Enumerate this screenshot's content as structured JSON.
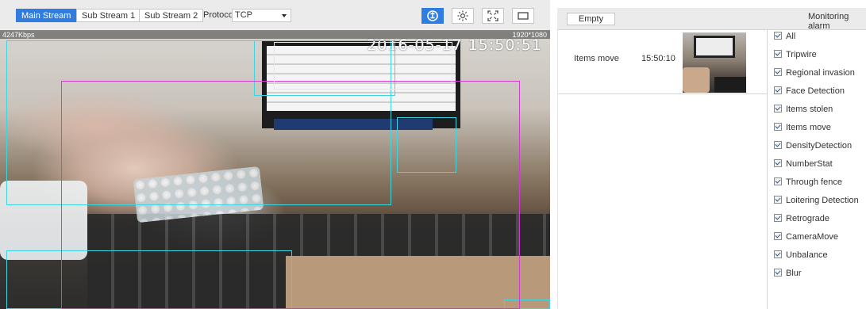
{
  "toolbar": {
    "streams": [
      {
        "label": "Main Stream",
        "active": true
      },
      {
        "label": "Sub Stream 1",
        "active": false
      },
      {
        "label": "Sub Stream 2",
        "active": false
      }
    ],
    "protocol_label": "Protocol",
    "protocol_value": "TCP",
    "icons": [
      {
        "name": "rule-overlay-icon",
        "active": true
      },
      {
        "name": "brightness-icon",
        "active": false
      },
      {
        "name": "fullscreen-icon",
        "active": false
      },
      {
        "name": "aspect-ratio-icon",
        "active": false
      }
    ]
  },
  "video": {
    "bitrate": "4247Kbps",
    "resolution": "1920*1080",
    "timestamp": "2016-05-17 15:50:51"
  },
  "alarm_panel": {
    "empty_label": "Empty",
    "title": "Monitoring alarm",
    "events": [
      {
        "type": "Items move",
        "time": "15:50:10"
      }
    ],
    "filters": [
      {
        "label": "All",
        "checked": true
      },
      {
        "label": "Tripwire",
        "checked": true
      },
      {
        "label": "Regional invasion",
        "checked": true
      },
      {
        "label": "Face Detection",
        "checked": true
      },
      {
        "label": "Items stolen",
        "checked": true
      },
      {
        "label": "Items move",
        "checked": true
      },
      {
        "label": "DensityDetection",
        "checked": true
      },
      {
        "label": "NumberStat",
        "checked": true
      },
      {
        "label": "Through fence",
        "checked": true
      },
      {
        "label": "Loitering Detection",
        "checked": true
      },
      {
        "label": "Retrograde",
        "checked": true
      },
      {
        "label": "CameraMove",
        "checked": true
      },
      {
        "label": "Unbalance",
        "checked": true
      },
      {
        "label": "Blur",
        "checked": true
      }
    ]
  },
  "colors": {
    "accent": "#2f7de1",
    "detection_cyan": "#3fd4de",
    "detection_magenta": "#d23cd2"
  }
}
